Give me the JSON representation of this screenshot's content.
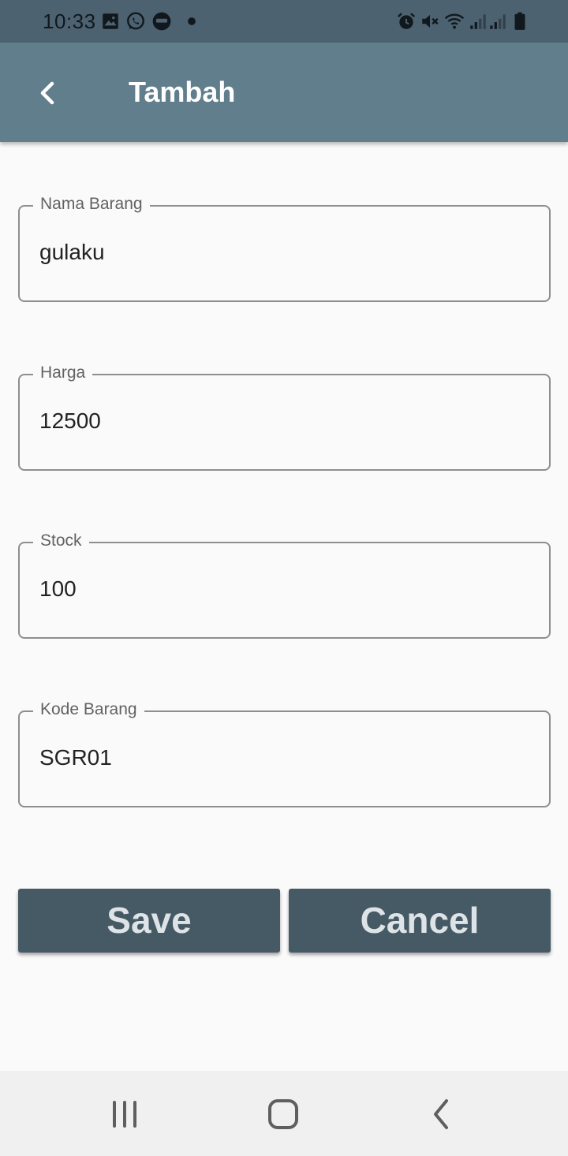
{
  "status_bar": {
    "time": "10:33",
    "left_icons": [
      "gallery-icon",
      "whatsapp-icon",
      "app-notification-icon",
      "notification-dot-icon"
    ],
    "right_icons": [
      "alarm-icon",
      "mute-icon",
      "wifi-icon",
      "signal-icon",
      "signal-icon",
      "battery-icon"
    ]
  },
  "app_bar": {
    "back_icon": "chevron-left-icon",
    "title": "Tambah"
  },
  "form": {
    "fields": [
      {
        "label": "Nama Barang",
        "value": "gulaku"
      },
      {
        "label": "Harga",
        "value": "12500"
      },
      {
        "label": "Stock",
        "value": "100"
      },
      {
        "label": "Kode Barang",
        "value": "SGR01"
      }
    ]
  },
  "actions": {
    "save_label": "Save",
    "cancel_label": "Cancel"
  },
  "nav_bar": {
    "icons": [
      "recent-apps-icon",
      "home-icon",
      "back-icon"
    ]
  },
  "colors": {
    "status_bar": "#4d6270",
    "app_bar": "#617e8c",
    "button": "#455a64",
    "background": "#fafafa",
    "nav_bar": "#f0f0f0"
  }
}
